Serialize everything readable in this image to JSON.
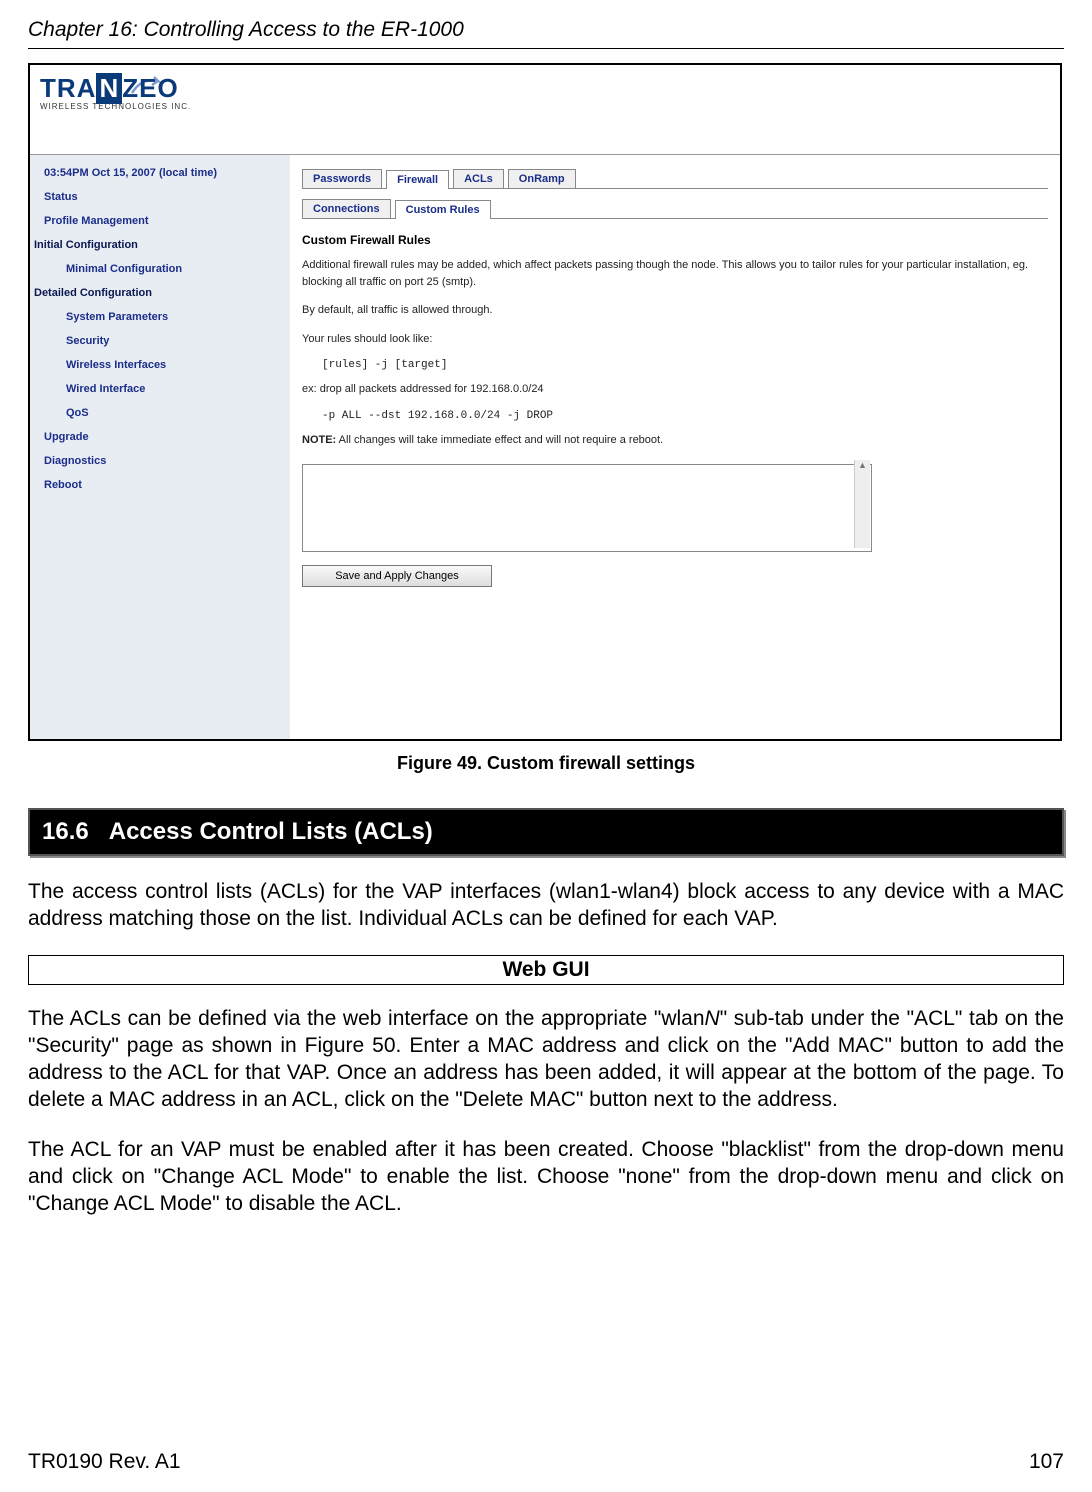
{
  "header": {
    "chapter": "Chapter 16: Controlling Access to the ER-1000"
  },
  "screenshot": {
    "logo_main": "TRANZEO",
    "logo_sub": "WIRELESS  TECHNOLOGIES INC.",
    "sidebar": {
      "items": [
        {
          "label": "03:54PM Oct 15, 2007 (local time)",
          "cls": ""
        },
        {
          "label": "Status",
          "cls": ""
        },
        {
          "label": "Profile Management",
          "cls": ""
        },
        {
          "label": "Initial Configuration",
          "cls": "group"
        },
        {
          "label": "Minimal Configuration",
          "cls": "sub"
        },
        {
          "label": "Detailed Configuration",
          "cls": "group"
        },
        {
          "label": "System Parameters",
          "cls": "sub"
        },
        {
          "label": "Security",
          "cls": "sub"
        },
        {
          "label": "Wireless Interfaces",
          "cls": "sub"
        },
        {
          "label": "Wired Interface",
          "cls": "sub"
        },
        {
          "label": "QoS",
          "cls": "sub"
        },
        {
          "label": "Upgrade",
          "cls": ""
        },
        {
          "label": "Diagnostics",
          "cls": ""
        },
        {
          "label": "Reboot",
          "cls": ""
        }
      ]
    },
    "tabs_top": [
      {
        "label": "Passwords",
        "active": false
      },
      {
        "label": "Firewall",
        "active": true
      },
      {
        "label": "ACLs",
        "active": false
      },
      {
        "label": "OnRamp",
        "active": false
      }
    ],
    "tabs_sub": [
      {
        "label": "Connections",
        "active": false
      },
      {
        "label": "Custom Rules",
        "active": true
      }
    ],
    "panel": {
      "heading": "Custom Firewall Rules",
      "p1": "Additional firewall rules may be added, which affect packets passing though the node. This allows you to tailor rules for your particular installation, eg. blocking all traffic on port 25 (smtp).",
      "p2": "By default, all traffic is allowed through.",
      "p3": "Your rules should look like:",
      "code1": "[rules] -j [target]",
      "p4": "ex: drop all packets addressed for 192.168.0.0/24",
      "code2": "-p ALL --dst 192.168.0.0/24 -j DROP",
      "note_label": "NOTE:",
      "note_text": " All changes will take immediate effect and will not require a reboot.",
      "button": "Save and Apply Changes"
    }
  },
  "figure_caption": "Figure 49. Custom firewall settings",
  "section": {
    "number": "16.6",
    "title": "Access Control Lists (ACLs)"
  },
  "para1": "The access control lists (ACLs) for the VAP interfaces (wlan1-wlan4) block access to any device with a MAC address matching those on the list. Individual ACLs can be defined for each VAP.",
  "webgui": "Web GUI",
  "para2_a": "The ACLs can be defined via the web interface on the appropriate \"wlan",
  "para2_n": "N",
  "para2_b": "\" sub-tab under the \"ACL\" tab on the \"Security\" page as shown in Figure 50. Enter a MAC address and click on the \"Add MAC\" button to add the address to the ACL for that VAP. Once an address has been added, it will appear at the bottom of the page. To delete a MAC address in an ACL, click on the \"Delete MAC\" button next to the address.",
  "para3": "The ACL for an VAP must be enabled after it has been created. Choose \"blacklist\" from the drop-down menu and click on \"Change ACL Mode\" to enable the list. Choose \"none\" from the drop-down menu and click on \"Change ACL Mode\" to disable the ACL.",
  "footer": {
    "left": "TR0190 Rev. A1",
    "right": "107"
  }
}
